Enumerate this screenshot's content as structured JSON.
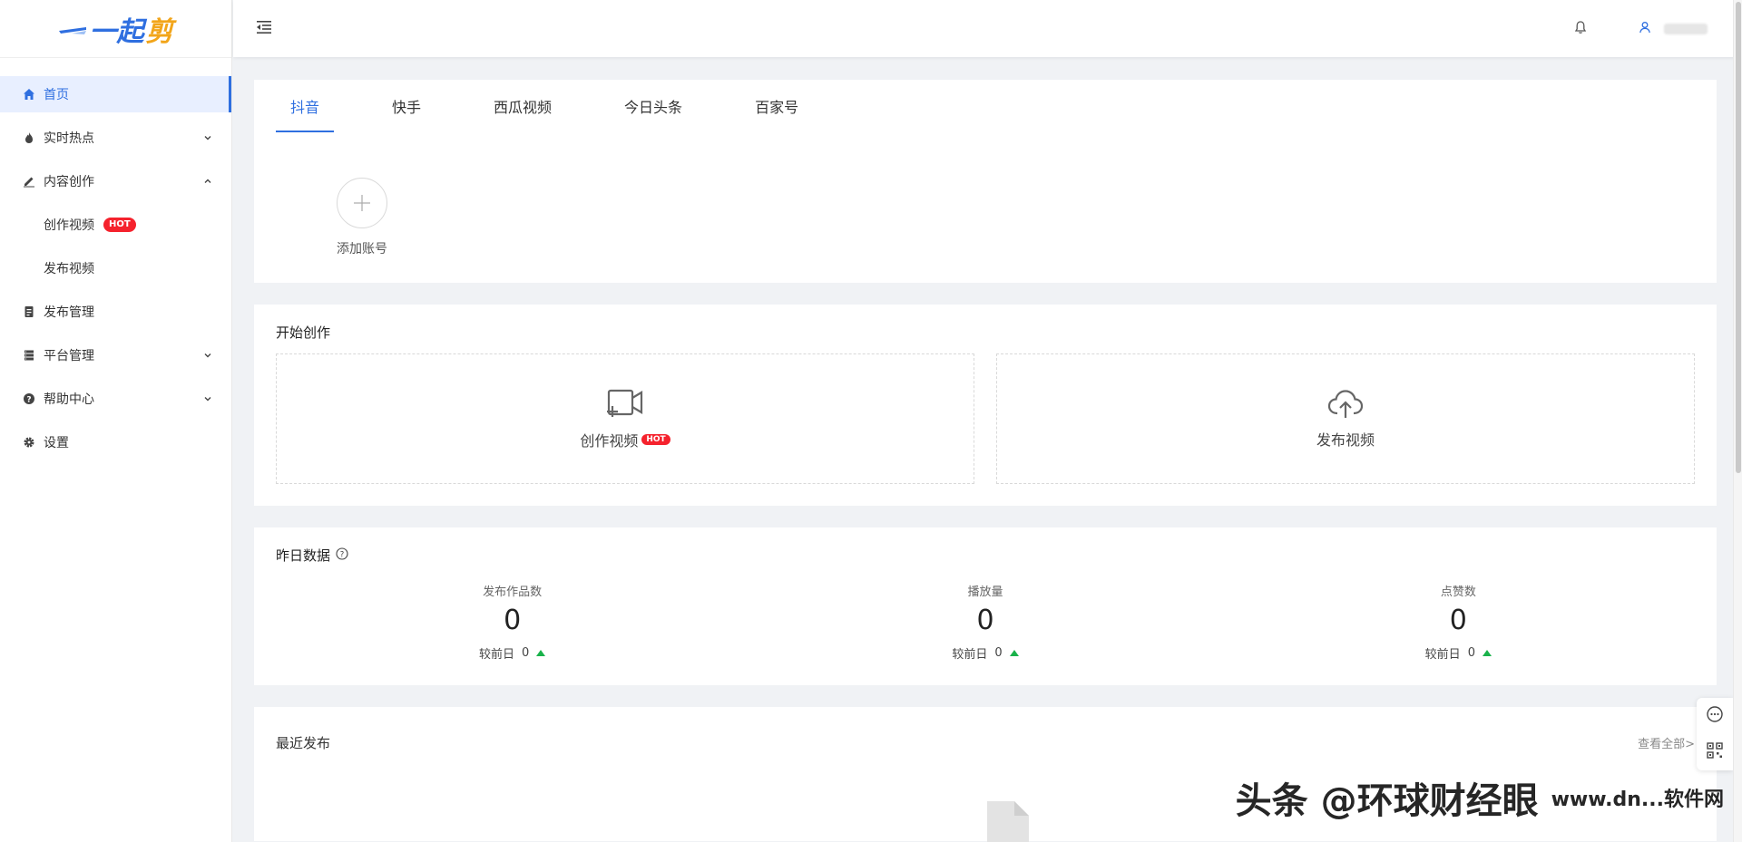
{
  "brand": {
    "logo_part_a": "一起",
    "logo_part_b": "剪"
  },
  "sidebar": {
    "items": [
      {
        "label": "首页",
        "icon": "home-icon"
      },
      {
        "label": "实时热点",
        "icon": "fire-icon"
      },
      {
        "label": "内容创作",
        "icon": "edit-icon"
      },
      {
        "label": "创作视频",
        "badge": "HOT"
      },
      {
        "label": "发布视频"
      },
      {
        "label": "发布管理",
        "icon": "publish-icon"
      },
      {
        "label": "平台管理",
        "icon": "server-icon"
      },
      {
        "label": "帮助中心",
        "icon": "help-icon"
      },
      {
        "label": "设置",
        "icon": "gear-icon"
      }
    ]
  },
  "platforms": {
    "tabs": [
      "抖音",
      "快手",
      "西瓜视频",
      "今日头条",
      "百家号"
    ],
    "active": "抖音",
    "add_account_label": "添加账号"
  },
  "create": {
    "title": "开始创作",
    "create_video_label": "创作视频",
    "create_video_badge": "HOT",
    "publish_video_label": "发布视频"
  },
  "yesterday": {
    "title": "昨日数据",
    "stats": [
      {
        "label": "发布作品数",
        "value": "0",
        "compare_label": "较前日",
        "compare_value": "0"
      },
      {
        "label": "播放量",
        "value": "0",
        "compare_label": "较前日",
        "compare_value": "0"
      },
      {
        "label": "点赞数",
        "value": "0",
        "compare_label": "较前日",
        "compare_value": "0"
      }
    ]
  },
  "recent": {
    "title": "最近发布",
    "view_all": "查看全部>"
  },
  "watermark": {
    "text": "头条 @环球财经眼",
    "site": "www.dn...软件网"
  },
  "colors": {
    "accent": "#2f6fe0",
    "hot": "#f5222d",
    "up": "#19b24a"
  }
}
